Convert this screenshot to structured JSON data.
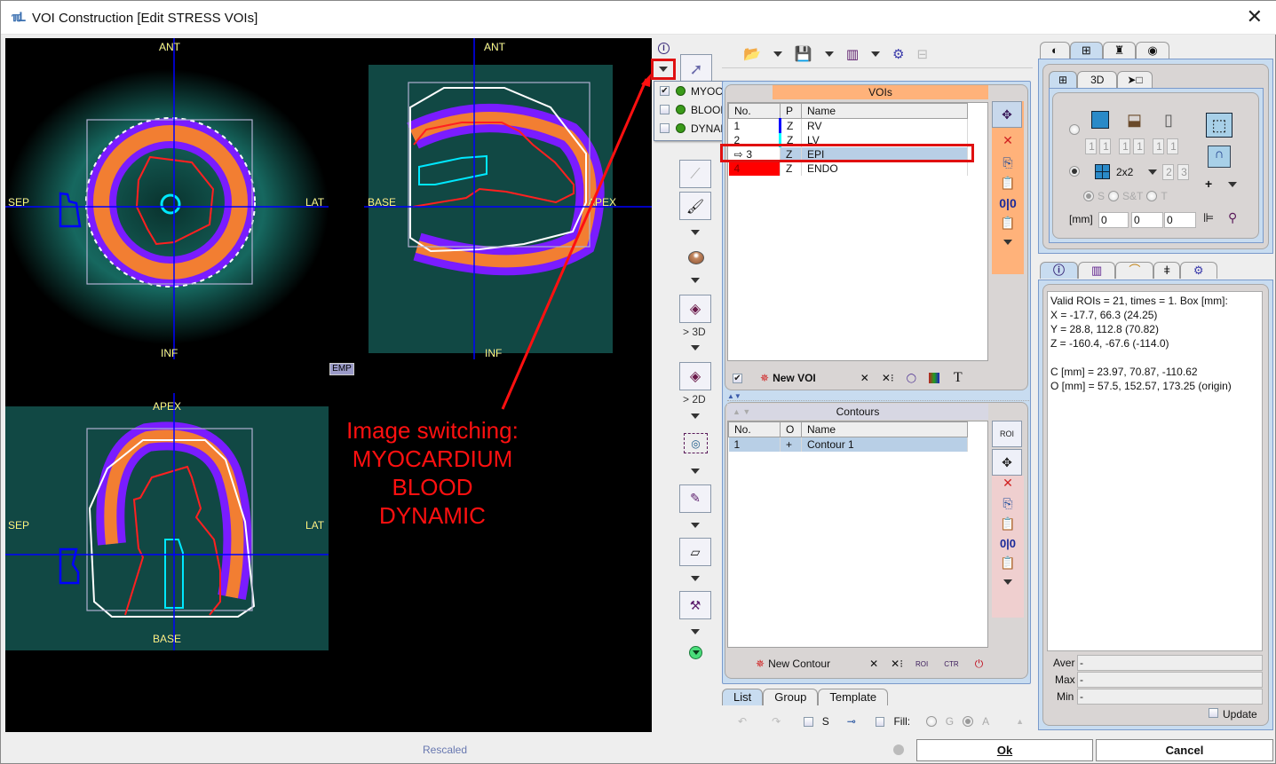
{
  "window": {
    "title": "VOI Construction [Edit STRESS VOIs]",
    "logo_icon": "pmod-logo-icon",
    "close_icon": "close-icon"
  },
  "viewer": {
    "views": [
      {
        "name": "short-axis",
        "top": "ANT",
        "bottom": "INF",
        "left": "SEP",
        "right": "LAT"
      },
      {
        "name": "long-axis-horizontal",
        "top": "ANT",
        "bottom": "INF",
        "left": "BASE",
        "right": "APEX"
      },
      {
        "name": "long-axis-vertical",
        "top": "APEX",
        "bottom": "BASE",
        "left": "SEP",
        "right": "LAT"
      }
    ],
    "emp_label": "EMP",
    "annotation": [
      "Image switching:",
      "MYOCARDIUM",
      "BLOOD",
      "DYNAMIC"
    ],
    "status": "Rescaled"
  },
  "image_menu": {
    "items": [
      {
        "label": "MYOCARDIUM",
        "checked": true
      },
      {
        "label": "BLOOD",
        "checked": false
      },
      {
        "label": "DYNAMIC",
        "checked": false
      }
    ]
  },
  "tools": {
    "to3d_label": "> 3D",
    "to2d_label": "> 2D"
  },
  "vois": {
    "header": "VOIs",
    "columns": [
      "No.",
      "P",
      "Name"
    ],
    "rows": [
      {
        "no": "1",
        "p": "Z",
        "name": "RV",
        "color": "#0000ff"
      },
      {
        "no": "2",
        "p": "Z",
        "name": "LV",
        "color": "#00ffff"
      },
      {
        "no": "3",
        "p": "Z",
        "name": "EPI",
        "color": "#ffffff",
        "selected": true
      },
      {
        "no": "4",
        "p": "Z",
        "name": "ENDO",
        "color": "#ff0000"
      }
    ],
    "new_voi_label": "New VOI"
  },
  "contours": {
    "header": "Contours",
    "columns": [
      "No.",
      "O",
      "Name"
    ],
    "rows": [
      {
        "no": "1",
        "o": "+",
        "name": "Contour 1"
      }
    ],
    "new_contour_label": "New Contour",
    "roi_label": "ROI",
    "ctr_label": "CTR"
  },
  "bottom_tabs": [
    "List",
    "Group",
    "Template"
  ],
  "bottom_controls": {
    "s_label": "S",
    "fill_label": "Fill:",
    "g_label": "G",
    "a_label": "A"
  },
  "layout_panel": {
    "subtabs": [
      "3D"
    ],
    "slice_fields": [
      [
        "1",
        "1"
      ],
      [
        "1",
        "1"
      ],
      [
        "1",
        "1"
      ]
    ],
    "grid_label": "2x2",
    "grid_fields": [
      "2",
      "3"
    ],
    "mode_options": [
      "S",
      "S&T",
      "T"
    ],
    "mm_label": "[mm]",
    "mm_values": [
      "0",
      "0",
      "0"
    ]
  },
  "info_panel": {
    "lines": [
      "Valid ROIs = 21, times = 1.  Box [mm]:",
      "X = -17.7, 66.3 (24.25)",
      "Y = 28.8, 112.8 (70.82)",
      "Z = -160.4, -67.6 (-114.0)",
      "",
      "C [mm] = 23.97, 70.87, -110.62",
      "O [mm] = 57.5, 152.57, 173.25 (origin)"
    ],
    "aver_label": "Aver",
    "aver_value": "-",
    "max_label": "Max",
    "max_value": "-",
    "min_label": "Min",
    "min_value": "-",
    "update_label": "Update"
  },
  "buttons": {
    "ok": "Ok",
    "cancel": "Cancel"
  }
}
